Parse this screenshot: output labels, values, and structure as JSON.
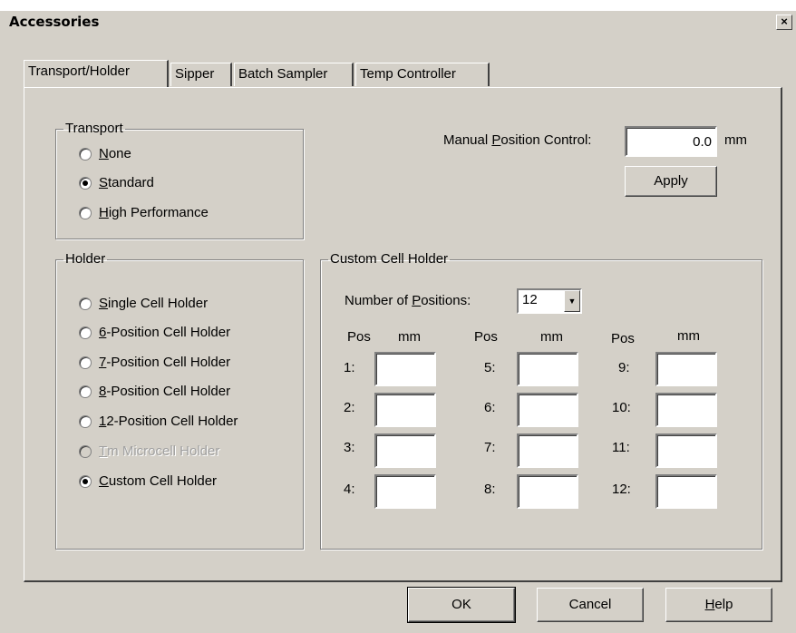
{
  "window": {
    "title": "Accessories",
    "close_glyph": "×"
  },
  "tabs": [
    {
      "label": "Transport/Holder",
      "active": true
    },
    {
      "label": "Sipper",
      "active": false
    },
    {
      "label": "Batch Sampler",
      "active": false
    },
    {
      "label": "Temp Controller",
      "active": false
    }
  ],
  "transport": {
    "legend": "Transport",
    "options": [
      {
        "pre": "",
        "key": "N",
        "post": "one",
        "checked": false
      },
      {
        "pre": "",
        "key": "S",
        "post": "tandard",
        "checked": true
      },
      {
        "pre": "",
        "key": "H",
        "post": "igh Performance",
        "checked": false
      }
    ]
  },
  "manual": {
    "label_pre": "Manual ",
    "label_key": "P",
    "label_post": "osition Control:",
    "value": "0.0",
    "unit": "mm",
    "apply_label": "Apply"
  },
  "holder": {
    "legend": "Holder",
    "options": [
      {
        "pre": "",
        "key": "S",
        "post": "ingle Cell Holder",
        "checked": false,
        "disabled": false
      },
      {
        "pre": "",
        "key": "6",
        "post": "-Position Cell Holder",
        "checked": false,
        "disabled": false
      },
      {
        "pre": "",
        "key": "7",
        "post": "-Position Cell Holder",
        "checked": false,
        "disabled": false
      },
      {
        "pre": "",
        "key": "8",
        "post": "-Position Cell Holder",
        "checked": false,
        "disabled": false
      },
      {
        "pre": "",
        "key": "1",
        "post": "2-Position Cell Holder",
        "checked": false,
        "disabled": false
      },
      {
        "pre": "",
        "key": "T",
        "post": "m Microcell Holder",
        "checked": false,
        "disabled": true
      },
      {
        "pre": "",
        "key": "C",
        "post": "ustom Cell Holder",
        "checked": true,
        "disabled": false
      }
    ]
  },
  "custom": {
    "legend": "Custom Cell Holder",
    "num_label_pre": "Number of ",
    "num_label_key": "P",
    "num_label_post": "ositions:",
    "num_value": "12",
    "col_pos": "Pos",
    "col_mm": "mm",
    "rows": [
      {
        "label": "1:",
        "value": ""
      },
      {
        "label": "2:",
        "value": ""
      },
      {
        "label": "3:",
        "value": ""
      },
      {
        "label": "4:",
        "value": ""
      },
      {
        "label": "5:",
        "value": ""
      },
      {
        "label": "6:",
        "value": ""
      },
      {
        "label": "7:",
        "value": ""
      },
      {
        "label": "8:",
        "value": ""
      },
      {
        "label": "9:",
        "value": ""
      },
      {
        "label": "10:",
        "value": ""
      },
      {
        "label": "11:",
        "value": ""
      },
      {
        "label": "12:",
        "value": ""
      }
    ]
  },
  "buttons": {
    "ok": "OK",
    "cancel": "Cancel",
    "help_key": "H",
    "help_post": "elp"
  }
}
